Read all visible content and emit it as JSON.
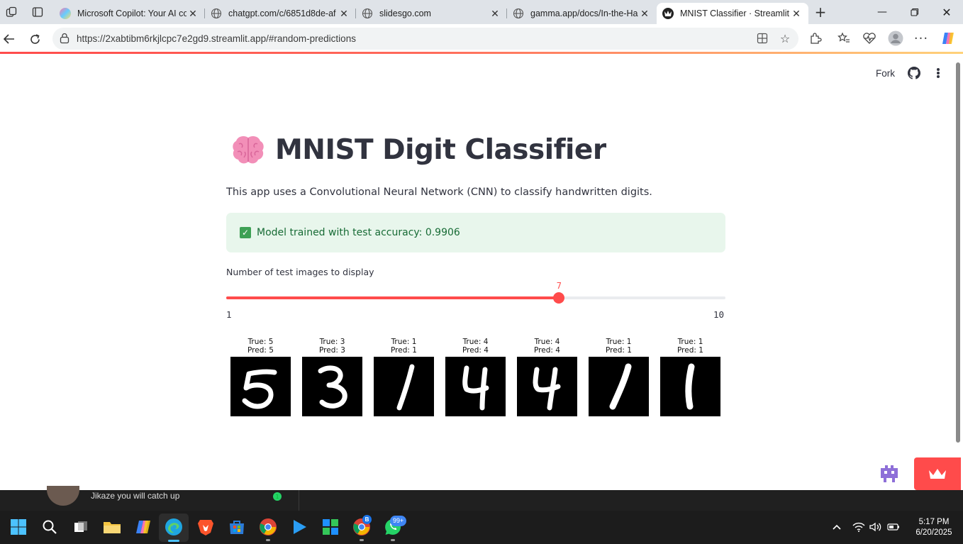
{
  "browser": {
    "tabs": [
      {
        "title": "Microsoft Copilot: Your AI co",
        "icon": "copilot-icon"
      },
      {
        "title": "chatgpt.com/c/6851d8de-af",
        "icon": "globe-icon"
      },
      {
        "title": "slidesgo.com",
        "icon": "globe-icon"
      },
      {
        "title": "gamma.app/docs/In-the-Ha",
        "icon": "globe-icon"
      },
      {
        "title": "MNIST Classifier · Streamlit",
        "icon": "streamlit-icon",
        "active": true
      }
    ],
    "url": "https://2xabtibm6rkjlcpc7e2gd9.streamlit.app/#random-predictions"
  },
  "header": {
    "fork_label": "Fork"
  },
  "app": {
    "title": "MNIST Digit Classifier",
    "title_emoji": "brain-emoji",
    "description": "This app uses a Convolutional Neural Network (CNN) to classify handwritten digits.",
    "success_message": "Model trained with test accuracy: 0.9906",
    "slider": {
      "label": "Number of test images to display",
      "min": "1",
      "max": "10",
      "value": "7"
    },
    "predictions": [
      {
        "true_label": "True: 5",
        "pred_label": "Pred: 5",
        "digit": "5"
      },
      {
        "true_label": "True: 3",
        "pred_label": "Pred: 3",
        "digit": "3"
      },
      {
        "true_label": "True: 1",
        "pred_label": "Pred: 1",
        "digit": "1"
      },
      {
        "true_label": "True: 4",
        "pred_label": "Pred: 4",
        "digit": "4"
      },
      {
        "true_label": "True: 4",
        "pred_label": "Pred: 4",
        "digit": "4"
      },
      {
        "true_label": "True: 1",
        "pred_label": "Pred: 1",
        "digit": "1"
      },
      {
        "true_label": "True: 1",
        "pred_label": "Pred: 1",
        "digit": "1"
      }
    ]
  },
  "notification_strip": {
    "text": "Jikaze you will catch up",
    "badge": "1"
  },
  "taskbar": {
    "time": "5:17 PM",
    "date": "6/20/2025",
    "whatsapp_badge": "99+",
    "chrome_profile_badge": "B"
  },
  "colors": {
    "accent": "#ff4b4b",
    "success_bg": "#e8f6ec",
    "success_text": "#176b35",
    "text": "#31333f"
  }
}
